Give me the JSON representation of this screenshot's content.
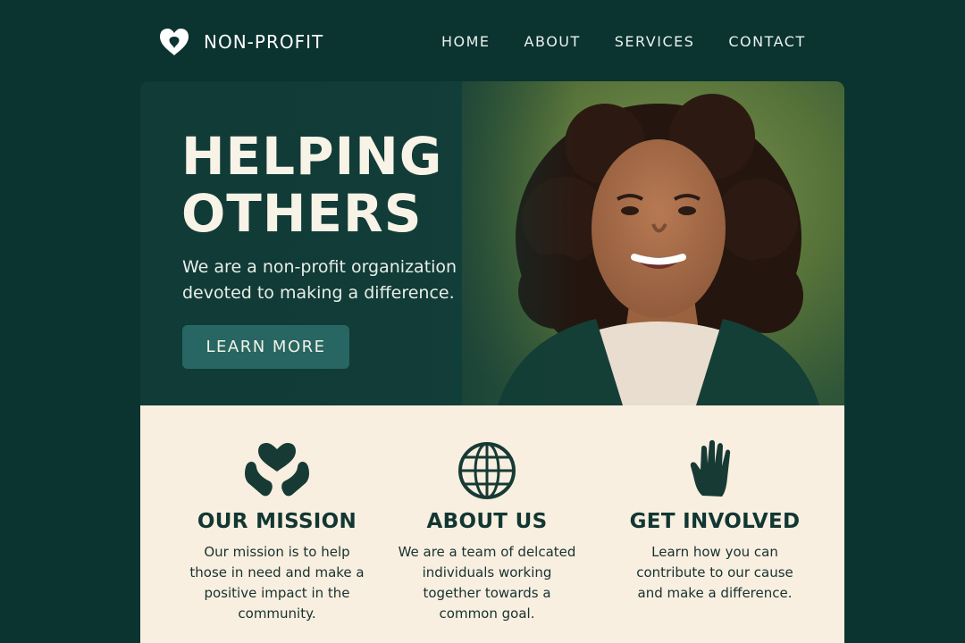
{
  "brand": {
    "name": "NON-PROFIT",
    "logo_icon": "heart-icon",
    "colors": {
      "background": "#0b332f",
      "accent": "#276663",
      "cream": "#f8efe0"
    }
  },
  "nav": {
    "items": [
      "HOME",
      "ABOUT",
      "SERVICES",
      "CONTACT"
    ]
  },
  "hero": {
    "title": "HELPING OTHERS",
    "subtitle": "We are a non-profit organization devoted to making a difference.",
    "button_label": "LEARN MORE",
    "photo_alt": "Smiling woman"
  },
  "features": [
    {
      "icon": "heart-hands-icon",
      "title": "OUR MISSION",
      "text": "Our mission is to help those in need and make a positive impact in the community."
    },
    {
      "icon": "globe-icon",
      "title": "ABOUT US",
      "text": "We are a team of delcated individuals working together towards a common goal."
    },
    {
      "icon": "hand-icon",
      "title": "GET INVOLVED",
      "text": "Learn how you can contribute to our cause and make a difference."
    }
  ]
}
